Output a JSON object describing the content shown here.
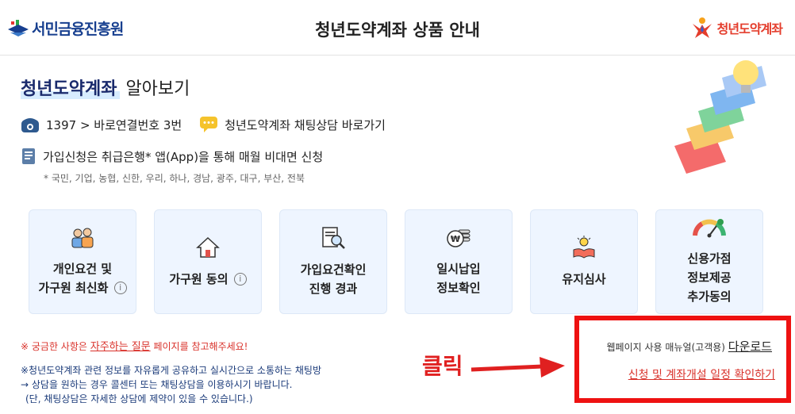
{
  "header": {
    "org_name": "서민금융진흥원",
    "title": "청년도약계좌 상품 안내",
    "brand_name": "청년도약계좌"
  },
  "hero": {
    "title_strong": "청년도약계좌",
    "title_rest": " 알아보기"
  },
  "contacts": {
    "phone": "1397 > 바로연결번호 3번",
    "chat": "청년도약계좌 채팅상담 바로가기"
  },
  "apply": {
    "text": "가입신청은 취급은행* 앱(App)을 통해 매월 비대면 신청",
    "banks": "* 국민, 기업, 농협, 신한, 우리, 하나, 경남, 광주, 대구, 부산, 전북"
  },
  "cards": [
    {
      "lines": [
        "개인요건 및",
        "가구원 최신화"
      ],
      "icon": "people-icon",
      "info": "i"
    },
    {
      "lines": [
        "가구원 동의"
      ],
      "icon": "house-icon",
      "info": "i"
    },
    {
      "lines": [
        "가입요건확인",
        "진행 경과"
      ],
      "icon": "document-search-icon"
    },
    {
      "lines": [
        "일시납입",
        "정보확인"
      ],
      "icon": "won-coin-icon"
    },
    {
      "lines": [
        "유지심사"
      ],
      "icon": "book-bulb-icon"
    },
    {
      "lines": [
        "신용가점",
        "정보제공",
        "추가동의"
      ],
      "icon": "gauge-icon"
    }
  ],
  "faq": {
    "prefix": "※ 궁금한 사항은 ",
    "link": "자주하는 질문",
    "suffix": " 페이지를 참고해주세요!"
  },
  "chat_note": {
    "line1": "※청년도약계좌 관련 정보를 자유롭게 공유하고 실시간으로 소통하는 채팅방",
    "line2": "→ 상담을 원하는 경우 콜센터 또는 채팅상담을 이용하시기 바랍니다.",
    "line3": "(단, 채팅상담은 자세한 상담에 제약이 있을 수 있습니다.)"
  },
  "annotation": {
    "click_label": "클릭"
  },
  "manual": {
    "label": "웹페이지 사용 매뉴얼(고객용) ",
    "download": "다운로드",
    "schedule_link": "신청 및 계좌개설 일정 확인하기"
  },
  "colors": {
    "brand_navy": "#173f8f",
    "accent_red": "#e43d2c",
    "card_bg": "#eef5ff",
    "annotation_red": "#ee1111"
  }
}
